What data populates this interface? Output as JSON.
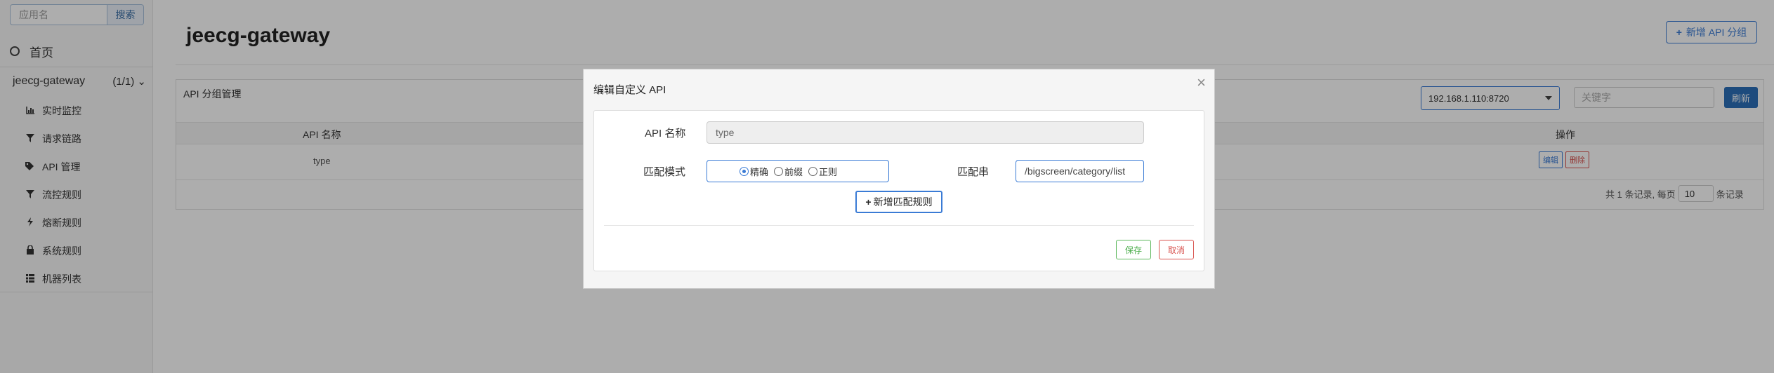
{
  "sidebar": {
    "search": {
      "placeholder": "应用名",
      "button_label": "搜索"
    },
    "home_label": "首页",
    "app": {
      "name": "jeecg-gateway",
      "count": "(1/1)"
    },
    "items": [
      {
        "label": "实时监控",
        "icon": "bar-chart-icon"
      },
      {
        "label": "请求链路",
        "icon": "filter-icon"
      },
      {
        "label": "API 管理",
        "icon": "tags-icon"
      },
      {
        "label": "流控规则",
        "icon": "filter-icon"
      },
      {
        "label": "熔断规则",
        "icon": "flash-icon"
      },
      {
        "label": "系统规则",
        "icon": "lock-icon"
      },
      {
        "label": "机器列表",
        "icon": "list-icon"
      }
    ]
  },
  "header": {
    "title": "jeecg-gateway",
    "new_group_label": "新增 API 分组"
  },
  "panel": {
    "title": "API 分组管理",
    "ip_select": "192.168.1.110:8720",
    "keyword_placeholder": "关键字",
    "refresh_label": "刷新",
    "columns": {
      "name": "API 名称",
      "actions": "操作"
    },
    "rows": [
      {
        "name": "type"
      }
    ],
    "edit_label": "编辑",
    "delete_label": "删除",
    "pager": {
      "prefix": "共 1 条记录, 每页",
      "page_size": "10",
      "suffix": "条记录"
    }
  },
  "modal": {
    "title": "编辑自定义 API",
    "close": "×",
    "api_name_label": "API 名称",
    "api_name_value": "type",
    "match_mode_label": "匹配模式",
    "modes": [
      {
        "label": "精确",
        "checked": true
      },
      {
        "label": "前缀",
        "checked": false
      },
      {
        "label": "正则",
        "checked": false
      }
    ],
    "pattern_label": "匹配串",
    "pattern_value": "/bigscreen/category/list",
    "add_rule_label": "新增匹配规则",
    "save_label": "保存",
    "cancel_label": "取消"
  },
  "colors": {
    "accent": "#3a7bd5",
    "danger": "#d9534f",
    "success": "#5cb85c",
    "primary_button": "#2c6fb8"
  }
}
